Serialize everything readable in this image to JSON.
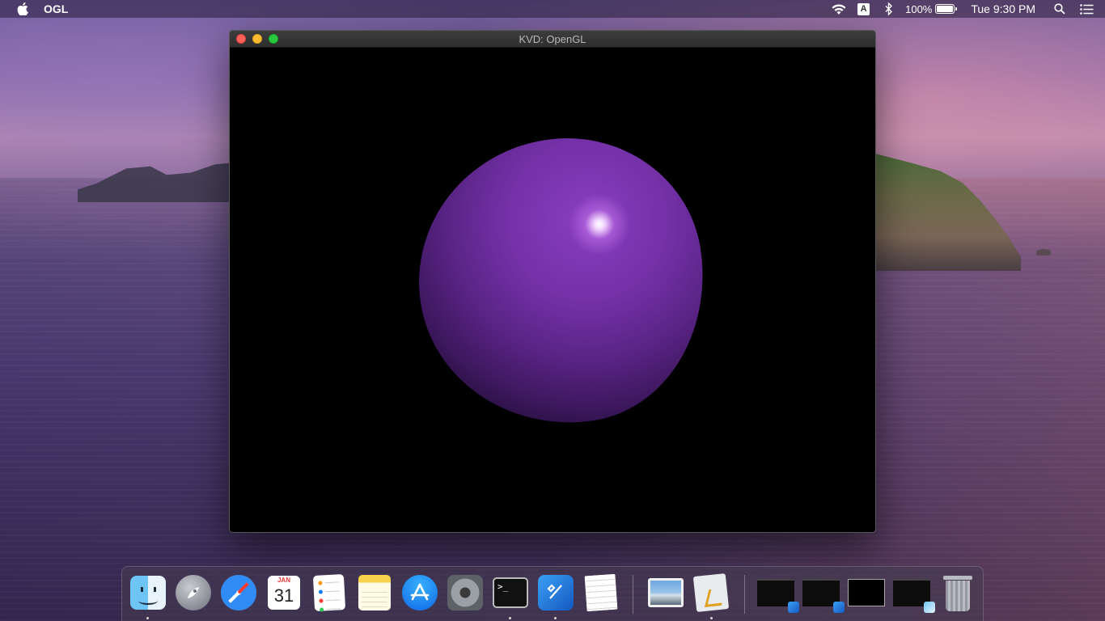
{
  "menubar": {
    "app_name": "OGL",
    "input_source": "A",
    "battery_percent": "100%",
    "clock": "Tue 9:30 PM"
  },
  "window": {
    "title": "KVD: OpenGL"
  },
  "scene": {
    "sphere_color": "#7431a8",
    "highlight_color": "#ffffff",
    "background_color": "#000000"
  },
  "dock": {
    "calendar_month": "JAN",
    "calendar_day": "31",
    "terminal_prompt": ">_",
    "apps": [
      "Finder",
      "Launchpad",
      "Safari",
      "Calendar",
      "Reminders",
      "Notes",
      "App Store",
      "System Preferences",
      "Terminal",
      "Xcode",
      "TextEdit",
      "Preview",
      "Instruments"
    ],
    "running": [
      "Finder",
      "Terminal",
      "Xcode",
      "Instruments"
    ]
  }
}
